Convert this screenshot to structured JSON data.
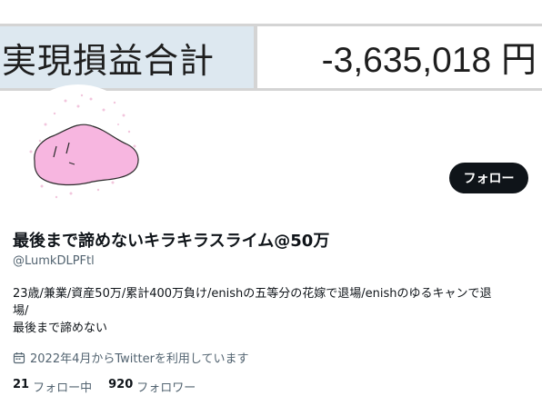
{
  "banner": {
    "label": "実現損益合計",
    "value": "-3,635,018 円"
  },
  "profile": {
    "follow_button": "フォロー",
    "display_name": "最後まで諦めないキラキラスライム@50万",
    "handle": "@LumkDLPFtl",
    "bio_lines": [
      "23歳/兼業/資産50万/累計400万負け/enishの五等分の花嫁で退場/enishのゆるキャンで退",
      "場/",
      "最後まで諦めない"
    ],
    "joined": "2022年4月からTwitterを利用しています",
    "following_count": "21",
    "following_label": "フォロー中",
    "followers_count": "920",
    "followers_label": "フォロワー"
  },
  "colors": {
    "banner_label_bg": "#dde8f0",
    "avatar_slime": "#f7b6e0",
    "button_bg": "#0f1419",
    "secondary_text": "#536471"
  },
  "icons": {
    "calendar": "calendar-icon"
  }
}
